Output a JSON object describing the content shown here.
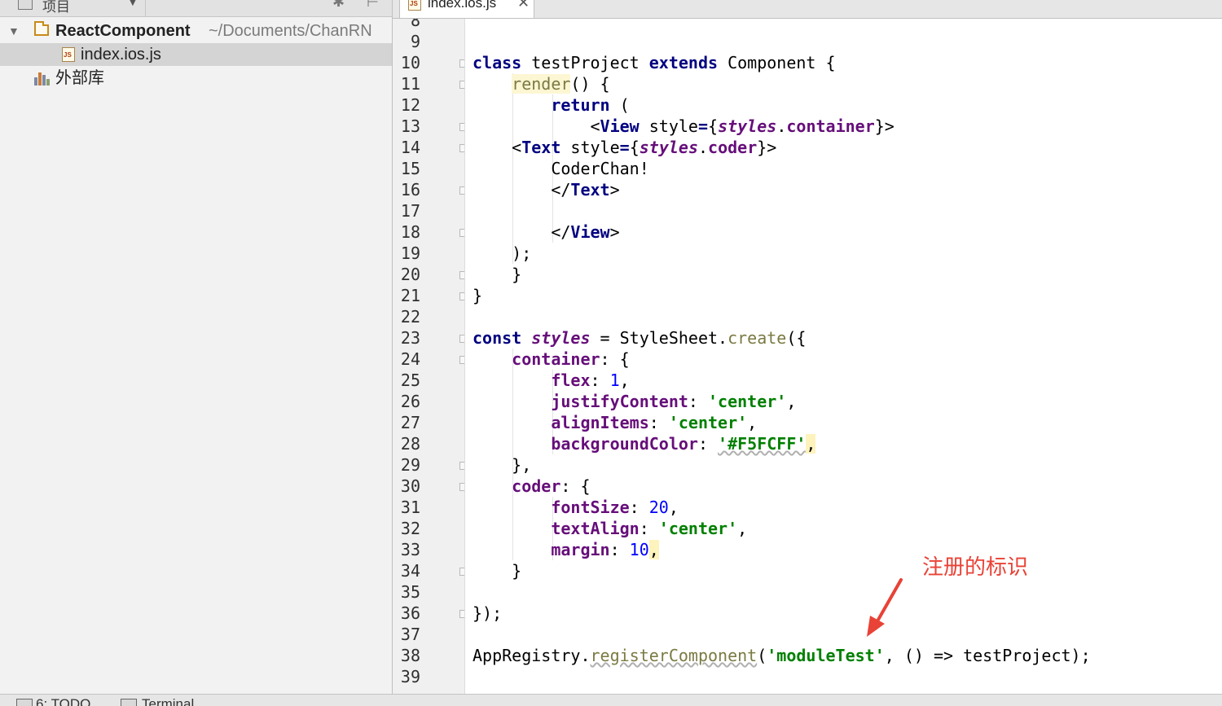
{
  "project_panel": {
    "title": "项目",
    "root_name": "ReactComponent",
    "root_path": "~/Documents/ChanRN",
    "file_name": "index.ios.js",
    "library_label": "外部库"
  },
  "editor": {
    "active_tab": "index.ios.js",
    "line_numbers": [
      "8",
      "9",
      "10",
      "11",
      "12",
      "13",
      "14",
      "15",
      "16",
      "17",
      "18",
      "19",
      "20",
      "21",
      "22",
      "23",
      "24",
      "25",
      "26",
      "27",
      "28",
      "29",
      "30",
      "31",
      "32",
      "33",
      "34",
      "35",
      "36",
      "37",
      "38",
      "39"
    ],
    "code_lines": [
      [],
      [],
      [
        {
          "t": "class",
          "c": "kw"
        },
        {
          "t": " testProject "
        },
        {
          "t": "extends",
          "c": "kw"
        },
        {
          "t": " Component {"
        }
      ],
      [
        {
          "t": "    "
        },
        {
          "t": "render",
          "c": "fn-render"
        },
        {
          "t": "() {"
        }
      ],
      [
        {
          "t": "        "
        },
        {
          "t": "return",
          "c": "kw"
        },
        {
          "t": " ("
        }
      ],
      [
        {
          "t": "            <"
        },
        {
          "t": "View",
          "c": "tag"
        },
        {
          "t": " style"
        },
        {
          "t": "=",
          "c": "kw"
        },
        {
          "t": "{"
        },
        {
          "t": "styles",
          "c": "ital"
        },
        {
          "t": "."
        },
        {
          "t": "container",
          "c": "prop"
        },
        {
          "t": "}>"
        }
      ],
      [
        {
          "t": "    <"
        },
        {
          "t": "Text",
          "c": "tag"
        },
        {
          "t": " style"
        },
        {
          "t": "=",
          "c": "kw"
        },
        {
          "t": "{"
        },
        {
          "t": "styles",
          "c": "ital"
        },
        {
          "t": "."
        },
        {
          "t": "coder",
          "c": "prop"
        },
        {
          "t": "}>"
        }
      ],
      [
        {
          "t": "        CoderChan!"
        }
      ],
      [
        {
          "t": "        </"
        },
        {
          "t": "Text",
          "c": "tag"
        },
        {
          "t": ">"
        }
      ],
      [],
      [
        {
          "t": "        </"
        },
        {
          "t": "View",
          "c": "tag"
        },
        {
          "t": ">"
        }
      ],
      [
        {
          "t": "    );"
        }
      ],
      [
        {
          "t": "    }"
        }
      ],
      [
        {
          "t": "}"
        }
      ],
      [],
      [
        {
          "t": "const",
          "c": "kw"
        },
        {
          "t": " "
        },
        {
          "t": "styles",
          "c": "ital"
        },
        {
          "t": " = StyleSheet."
        },
        {
          "t": "create",
          "c": "meth"
        },
        {
          "t": "({"
        }
      ],
      [
        {
          "t": "    "
        },
        {
          "t": "container",
          "c": "prop"
        },
        {
          "t": ": {"
        }
      ],
      [
        {
          "t": "        "
        },
        {
          "t": "flex",
          "c": "prop"
        },
        {
          "t": ": "
        },
        {
          "t": "1",
          "c": "num"
        },
        {
          "t": ","
        }
      ],
      [
        {
          "t": "        "
        },
        {
          "t": "justifyContent",
          "c": "prop"
        },
        {
          "t": ": "
        },
        {
          "t": "'center'",
          "c": "str"
        },
        {
          "t": ","
        }
      ],
      [
        {
          "t": "        "
        },
        {
          "t": "alignItems",
          "c": "prop"
        },
        {
          "t": ": "
        },
        {
          "t": "'center'",
          "c": "str"
        },
        {
          "t": ","
        }
      ],
      [
        {
          "t": "        "
        },
        {
          "t": "backgroundColor",
          "c": "prop"
        },
        {
          "t": ": "
        },
        {
          "t": "'#F5FCFF'",
          "c": "str squig"
        },
        {
          "t": ",",
          "c": "hl-comma"
        }
      ],
      [
        {
          "t": "    },"
        }
      ],
      [
        {
          "t": "    "
        },
        {
          "t": "coder",
          "c": "prop"
        },
        {
          "t": ": {"
        }
      ],
      [
        {
          "t": "        "
        },
        {
          "t": "fontSize",
          "c": "prop"
        },
        {
          "t": ": "
        },
        {
          "t": "20",
          "c": "num"
        },
        {
          "t": ","
        }
      ],
      [
        {
          "t": "        "
        },
        {
          "t": "textAlign",
          "c": "prop"
        },
        {
          "t": ": "
        },
        {
          "t": "'center'",
          "c": "str"
        },
        {
          "t": ","
        }
      ],
      [
        {
          "t": "        "
        },
        {
          "t": "margin",
          "c": "prop"
        },
        {
          "t": ": "
        },
        {
          "t": "10",
          "c": "num"
        },
        {
          "t": ",",
          "c": "hl-comma"
        }
      ],
      [
        {
          "t": "    }"
        }
      ],
      [],
      [
        {
          "t": "});"
        }
      ],
      [],
      [
        {
          "t": "AppRegistry."
        },
        {
          "t": "registerComponent",
          "c": "meth squig"
        },
        {
          "t": "("
        },
        {
          "t": "'moduleTest'",
          "c": "str"
        },
        {
          "t": ", () => testProject);"
        }
      ],
      []
    ]
  },
  "annotation": {
    "label": "注册的标识",
    "color": "#e94236"
  },
  "bottom_bar": {
    "todo_label": "6: TODO",
    "terminal_label": "Terminal"
  },
  "colors": {
    "keyword": "#000080",
    "property": "#660e7a",
    "string": "#008000",
    "number": "#0000ff",
    "method": "#7a7a43"
  }
}
